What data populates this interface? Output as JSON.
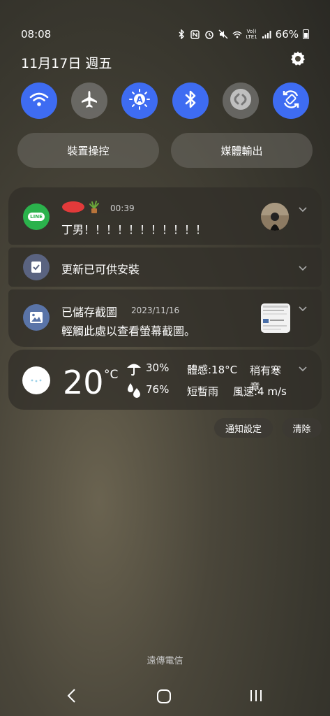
{
  "status_bar": {
    "time": "08:08",
    "carrier_badge_top": "Vo))",
    "carrier_badge_bottom": "LTE1",
    "battery": "66%"
  },
  "header": {
    "date": "11月17日 週五"
  },
  "quick_settings": {
    "toggles": [
      {
        "name": "wifi",
        "icon": "wifi-icon",
        "state": "on"
      },
      {
        "name": "airplane",
        "icon": "airplane-icon",
        "state": "off"
      },
      {
        "name": "auto-brightness",
        "icon": "brightness-auto-icon",
        "state": "on"
      },
      {
        "name": "bluetooth",
        "icon": "bluetooth-icon",
        "state": "on"
      },
      {
        "name": "shazam",
        "icon": "shazam-icon",
        "state": "off"
      },
      {
        "name": "auto-rotate",
        "icon": "rotate-icon",
        "state": "on"
      }
    ],
    "device_control": "裝置操控",
    "media_output": "媒體輸出"
  },
  "notifications": {
    "line": {
      "app_label": "LINE",
      "time": "00:39",
      "message": "丁男！！！！！！！！！！！"
    },
    "update": {
      "title": "更新已可供安裝"
    },
    "screenshot": {
      "title": "已儲存截圖",
      "date": "2023/11/16",
      "message": "輕觸此處以查看螢幕截圖。"
    },
    "weather": {
      "temperature": "20",
      "unit": "°C",
      "rain_chance": "30%",
      "humidity": "76%",
      "feels_like": "體感:18°C",
      "condition1": "稍有寒意",
      "condition2": "短暫雨",
      "wind": "風速:4 m/s"
    }
  },
  "actions": {
    "settings": "通知設定",
    "clear": "清除"
  },
  "footer": {
    "carrier": "遠傳電信"
  },
  "colors": {
    "accent": "#3e6cf2",
    "line_green": "#2bb24c"
  }
}
